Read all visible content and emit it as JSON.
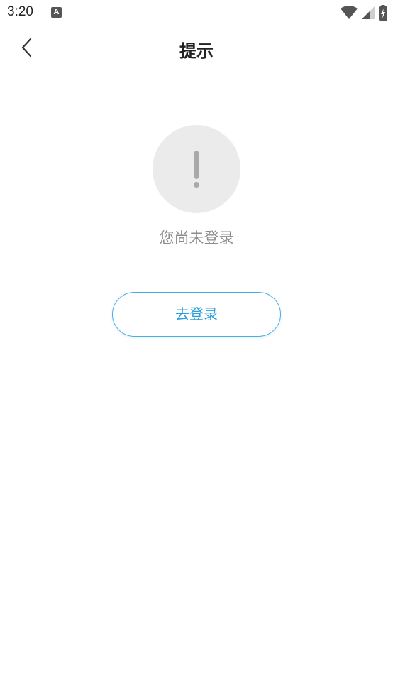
{
  "status_bar": {
    "time": "3:20",
    "app_icon_letter": "A",
    "icons": [
      "wifi-icon",
      "cellular-signal-icon",
      "battery-charging-icon"
    ]
  },
  "header": {
    "title": "提示",
    "back_icon": "chevron-left-icon"
  },
  "content": {
    "alert_icon": "exclamation-icon",
    "message": "您尚未登录",
    "login_button_label": "去登录"
  },
  "colors": {
    "accent": "#2a9fdc",
    "accent_border": "#4aaee6",
    "message_text": "#8c8c8c",
    "circle_bg": "#ebebeb",
    "exclamation": "#a9a9a9"
  }
}
